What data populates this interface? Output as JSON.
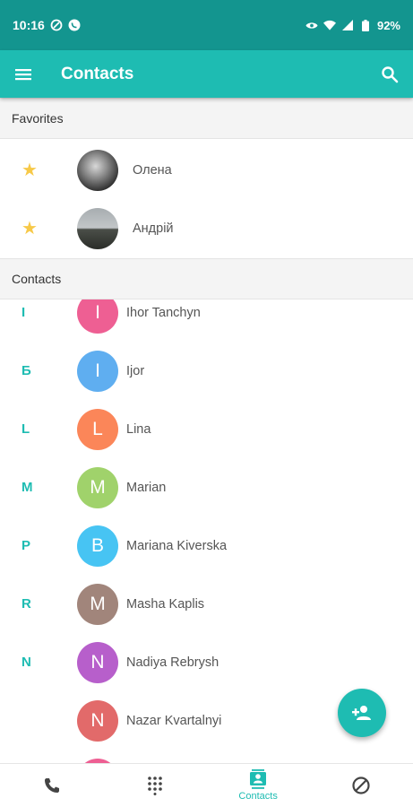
{
  "status_bar": {
    "time": "10:16",
    "battery": "92%",
    "icons": [
      "data-saver-icon",
      "whatsapp-icon",
      "eye-icon",
      "wifi-icon",
      "signal-icon",
      "battery-icon"
    ]
  },
  "app_bar": {
    "title": "Contacts",
    "menu_icon": "menu-icon",
    "search_icon": "search-icon",
    "color": "#1ebcb2"
  },
  "favorites": {
    "header": "Favorites",
    "items": [
      {
        "name": "Олена",
        "icon": "star-icon"
      },
      {
        "name": "Андрій",
        "icon": "star-icon"
      }
    ]
  },
  "contacts": {
    "header": "Contacts",
    "items": [
      {
        "letter": "I",
        "initial": "I",
        "name": "Ihor Tanchyn",
        "color": "#ee5f93"
      },
      {
        "letter": "Б",
        "initial": "I",
        "name": "Ijor",
        "color": "#5faef0"
      },
      {
        "letter": "L",
        "initial": "L",
        "name": "Lina",
        "color": "#fb8659"
      },
      {
        "letter": "M",
        "initial": "M",
        "name": "Marian",
        "color": "#a0d26b"
      },
      {
        "letter": "P",
        "initial": "B",
        "name": "Mariana Kiverska",
        "color": "#47c4f3"
      },
      {
        "letter": "R",
        "initial": "M",
        "name": "Masha Kaplis",
        "color": "#a1857b"
      },
      {
        "letter": "N",
        "initial": "N",
        "name": "Nadiya Rebrysh",
        "color": "#b75fcb"
      },
      {
        "letter": "",
        "initial": "N",
        "name": "Nazar Kvartalnyi",
        "color": "#e26a6a"
      }
    ]
  },
  "fab": {
    "icon": "add-person-icon"
  },
  "bottom_nav": {
    "items": [
      {
        "icon": "phone-icon",
        "label": ""
      },
      {
        "icon": "dialpad-icon",
        "label": ""
      },
      {
        "icon": "contacts-icon",
        "label": "Contacts"
      },
      {
        "icon": "blocked-icon",
        "label": ""
      }
    ]
  }
}
